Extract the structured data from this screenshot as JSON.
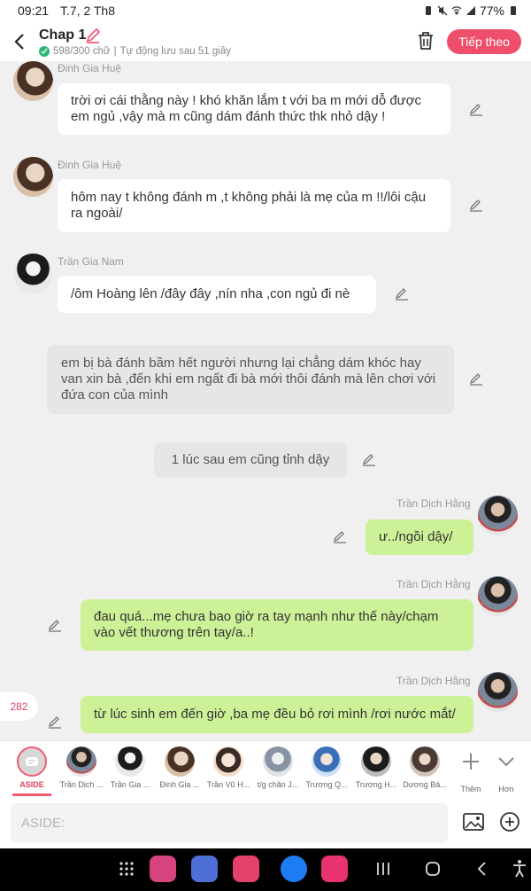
{
  "status_bar": {
    "time": "09:21",
    "date": "T.7, 2 Th8",
    "battery": "77%"
  },
  "header": {
    "title": "Chap 1",
    "subtitle_count": "598/300 chữ",
    "subtitle_autosave": "Tự động lưu sau 51 giây",
    "next_label": "Tiếp theo"
  },
  "messages": [
    {
      "sender": "Đinh Gia Huệ",
      "text": "trời ơi cái thằng này ! khó khăn lắm t với ba m mới dỗ được em ngủ ,vậy mà m cũng dám đánh thức thk nhỏ dậy !"
    },
    {
      "sender": "Đinh Gia Huệ",
      "text": "hôm nay t không đánh m ,t không phải là mẹ của m !!/lôi cậu ra ngoài/"
    },
    {
      "sender": "Trần Gia Nam",
      "text": "/ôm Hoàng lên /đây đây ,nín nha ,con ngủ đi nè"
    },
    {
      "sender": "",
      "text": "em bị bà đánh bầm hết người nhưng lại chẳng dám khóc hay van xin bà ,đến khi em ngất đi bà mới thôi đánh mà lên chơi với đứa con của mình"
    },
    {
      "sender": "",
      "text": "1 lúc sau em cũng tỉnh dậy"
    },
    {
      "sender": "Trần Dịch Hằng",
      "text": "ư../ngồi dậy/"
    },
    {
      "sender": "Trần Dịch Hằng",
      "text": "đau quá...mẹ chưa bao giờ ra tay mạnh như thế này/chạm vào vết thương trên tay/a..!"
    },
    {
      "sender": "Trần Dịch Hằng",
      "text": "từ lúc sinh em đến giờ ,ba mẹ đều bỏ rơi mình /rơi nước mắt/"
    }
  ],
  "counter": "282",
  "characters": [
    {
      "name": "ASIDE"
    },
    {
      "name": "Trần Dịch ..."
    },
    {
      "name": "Trần Gia ..."
    },
    {
      "name": "Đinh Gia ..."
    },
    {
      "name": "Trần Vũ H..."
    },
    {
      "name": "t/g chăn J..."
    },
    {
      "name": "Trương Q..."
    },
    {
      "name": "Trương H..."
    },
    {
      "name": "Dương Bá..."
    }
  ],
  "more_label": "Thêm",
  "collapse_label": "Hơn",
  "input": {
    "placeholder": "ASIDE:"
  },
  "colors": {
    "accent": "#f04f6b",
    "green_bubble": "#cdf197",
    "white_bubble": "#ffffff",
    "narration_bubble": "#e6e6e6"
  }
}
